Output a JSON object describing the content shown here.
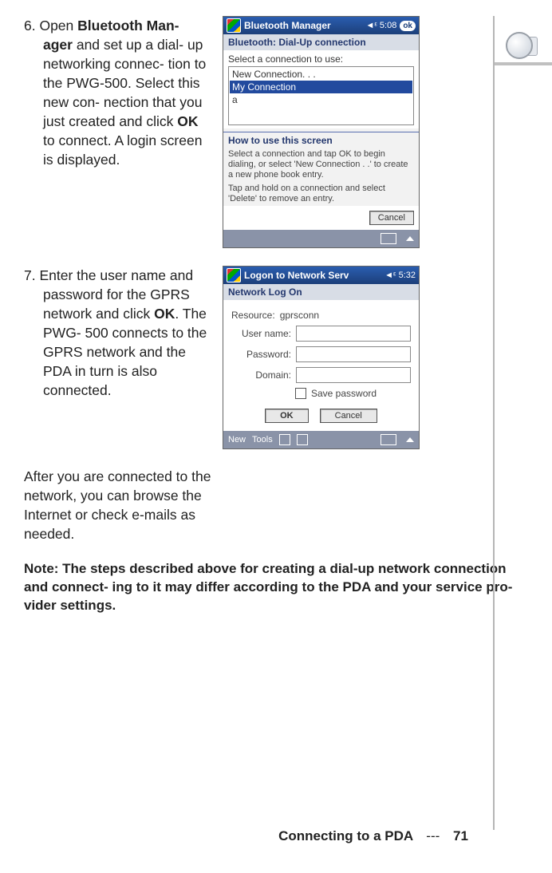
{
  "steps": [
    {
      "number": "6.",
      "html": "Open <b>Bluetooth Man- ager</b> and set up a dial- up networking connec- tion to the PWG-500. Select this new con- nection that you just created and click <b>OK</b> to connect. A login screen is displayed."
    },
    {
      "number": "7.",
      "html": "Enter the user name and password for the GPRS network and click <b>OK</b>. The PWG- 500 connects to the GPRS network and the PDA in turn is also connected."
    }
  ],
  "after_para": "After you are connected to the network, you can browse the Internet or check e-mails as needed.",
  "note": "Note: The steps described above for creating a dial-up network connection and connect- ing to it may differ according to the PDA and your service pro- vider settings.",
  "pda1": {
    "title": "Bluetooth Manager",
    "time": "◄ᵋ 5:08",
    "ok": "ok",
    "subhead": "Bluetooth: Dial-Up connection",
    "select_label": "Select a connection to use:",
    "items": [
      "New Connection. . .",
      "My Connection",
      "a"
    ],
    "section_title": "How to use this screen",
    "help1": "Select a connection and tap OK to begin dialing, or select 'New Connection . .' to create a new phone book entry.",
    "help2": "Tap and hold on a connection and select 'Delete' to remove an entry.",
    "cancel": "Cancel"
  },
  "pda2": {
    "title": "Logon to Network Serv",
    "time": "◄ᵋ 5:32",
    "subhead": "Network Log On",
    "resource_lbl": "Resource:",
    "resource_val": "gprsconn",
    "user_lbl": "User name:",
    "pass_lbl": "Password:",
    "dom_lbl": "Domain:",
    "save_lbl": "Save password",
    "ok": "OK",
    "cancel": "Cancel",
    "bottom_new": "New",
    "bottom_tools": "Tools"
  },
  "footer": {
    "section": "Connecting to a PDA",
    "dash": "---",
    "page": "71"
  }
}
